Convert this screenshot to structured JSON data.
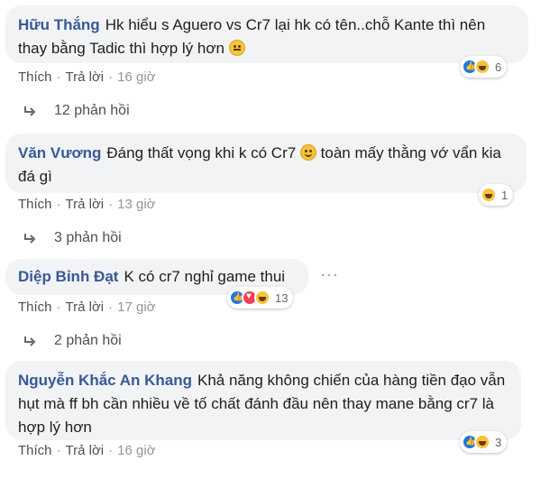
{
  "comments": [
    {
      "author": "Hữu Thắng",
      "text": "Hk hiểu s Aguero vs Cr7 lại hk có tên..chỗ Kante thì nên thay bằng Tadic thì hợp lý hơn",
      "actions": {
        "like": "Thích",
        "reply": "Trả lời",
        "time": "16 giờ"
      },
      "reactions": {
        "types": [
          "like",
          "haha"
        ],
        "count": "6"
      },
      "replies": "12 phản hồi"
    },
    {
      "author": "Văn Vương",
      "text_a": "Đáng thất vọng khi k có Cr7",
      "text_b": "toàn mấy thằng vớ vẩn kia đá gì",
      "actions": {
        "like": "Thích",
        "reply": "Trả lời",
        "time": "13 giờ"
      },
      "reactions": {
        "types": [
          "haha"
        ],
        "count": "1"
      },
      "replies": "3 phản hồi"
    },
    {
      "author": "Diệp Bỉnh Đạt",
      "text": "K có cr7 nghỉ game thui",
      "more": "···",
      "actions": {
        "like": "Thích",
        "reply": "Trả lời",
        "time": "17 giờ"
      },
      "reactions": {
        "types": [
          "like",
          "love",
          "haha"
        ],
        "count": "13"
      },
      "replies": "2 phản hồi"
    },
    {
      "author": "Nguyễn Khắc An Khang",
      "text": "Khả năng không chiến của hàng tiền đạo vẫn hụt mà ff bh cần nhiều về tố chất đánh đầu nên thay mane bằng cr7 là hợp lý hơn",
      "actions": {
        "like": "Thích",
        "reply": "Trả lời",
        "time": "16 giờ"
      },
      "reactions": {
        "types": [
          "like",
          "haha"
        ],
        "count": "3"
      }
    }
  ],
  "dot": "·"
}
